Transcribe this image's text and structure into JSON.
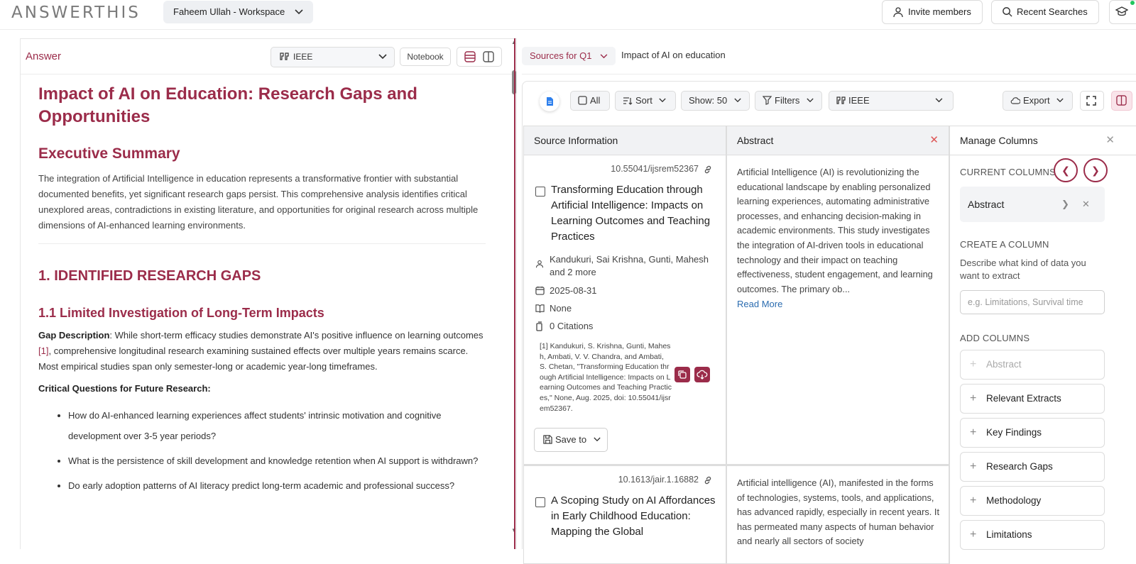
{
  "app": {
    "logo": "ANSWERTHIS",
    "workspace": "Faheem Ullah - Workspace",
    "invite_label": "Invite members",
    "recent_label": "Recent Searches"
  },
  "answer": {
    "label": "Answer",
    "citation_style": "IEEE",
    "notebook_label": "Notebook",
    "title": "Impact of AI on Education: Research Gaps and Opportunities",
    "exec_heading": "Executive Summary",
    "exec_text": "The integration of Artificial Intelligence in education represents a transformative frontier with substantial documented benefits, yet significant research gaps persist. This comprehensive analysis identifies critical unexplored areas, contradictions in existing literature, and opportunities for original research across multiple dimensions of AI-enhanced learning environments.",
    "section1": "1. IDENTIFIED RESEARCH GAPS",
    "section1_1": "1.1 Limited Investigation of Long-Term Impacts",
    "gap_label": "Gap Description",
    "gap_text_a": ": While short-term efficacy studies demonstrate AI's positive influence on learning outcomes ",
    "gap_cite": "[1]",
    "gap_text_b": ", comprehensive longitudinal research examining sustained effects over multiple years remains scarce. Most empirical studies span only semester-long or academic year-long timeframes.",
    "questions_heading": "Critical Questions for Future Research:",
    "questions": [
      "How do AI-enhanced learning experiences affect students' intrinsic motivation and cognitive development over 3-5 year periods?",
      "What is the persistence of skill development and knowledge retention when AI support is withdrawn?",
      "Do early adoption patterns of AI literacy predict long-term academic and professional success?"
    ]
  },
  "sources": {
    "dropdown_label": "Sources for Q1",
    "query_title": "Impact of AI on education",
    "toolbar": {
      "all": "All",
      "sort": "Sort",
      "show": "Show: 50",
      "filters": "Filters",
      "style": "IEEE",
      "export": "Export"
    },
    "columns": {
      "source": "Source Information",
      "abstract": "Abstract",
      "manage": "Manage Columns"
    },
    "rows": [
      {
        "doi": "10.55041/ijsrem52367",
        "title": "Transforming Education through Artificial Intelligence: Impacts on Learning Outcomes and Teaching Practices",
        "authors": "Kandukuri, Sai Krishna, Gunti, Mahesh and 2 more",
        "date": "2025-08-31",
        "venue": "None",
        "citations": "0 Citations",
        "reference": "[1] Kandukuri, S. Krishna, Gunti, Mahesh, Ambati, V. V. Chandra, and Ambati, S. Chetan, \"Transforming Education through Artificial Intelligence: Impacts on Learning Outcomes and Teaching Practices,\" None, Aug. 2025, doi: 10.55041/ijsrem52367.",
        "save_label": "Save to",
        "abstract": "Artificial Intelligence (AI) is revolutionizing the educational landscape by enabling personalized learning experiences, automating administrative processes, and enhancing decision-making in academic environments. This study investigates the integration of AI-driven tools in educational technology and their impact on teaching effectiveness, student engagement, and learning outcomes. The primary ob...",
        "read_more": "Read More"
      },
      {
        "doi": "10.1613/jair.1.16882",
        "title": "A Scoping Study on AI Affordances in Early Childhood Education: Mapping the Global",
        "abstract": "Artificial intelligence (AI), manifested in the forms of technologies, systems, tools, and applications, has advanced rapidly, especially in recent years. It has permeated many aspects of human behavior and nearly all sectors of society"
      }
    ],
    "manage": {
      "current_heading": "CURRENT COLUMNS",
      "current": [
        "Abstract"
      ],
      "create_heading": "CREATE A COLUMN",
      "create_desc": "Describe what kind of data you want to extract",
      "create_placeholder": "e.g. Limitations, Survival time",
      "add_heading": "ADD COLUMNS",
      "add": [
        "Abstract",
        "Relevant Extracts",
        "Key Findings",
        "Research Gaps",
        "Methodology",
        "Limitations"
      ]
    }
  },
  "colors": {
    "accent": "#9b2c4a",
    "link": "#2b6cb0"
  }
}
